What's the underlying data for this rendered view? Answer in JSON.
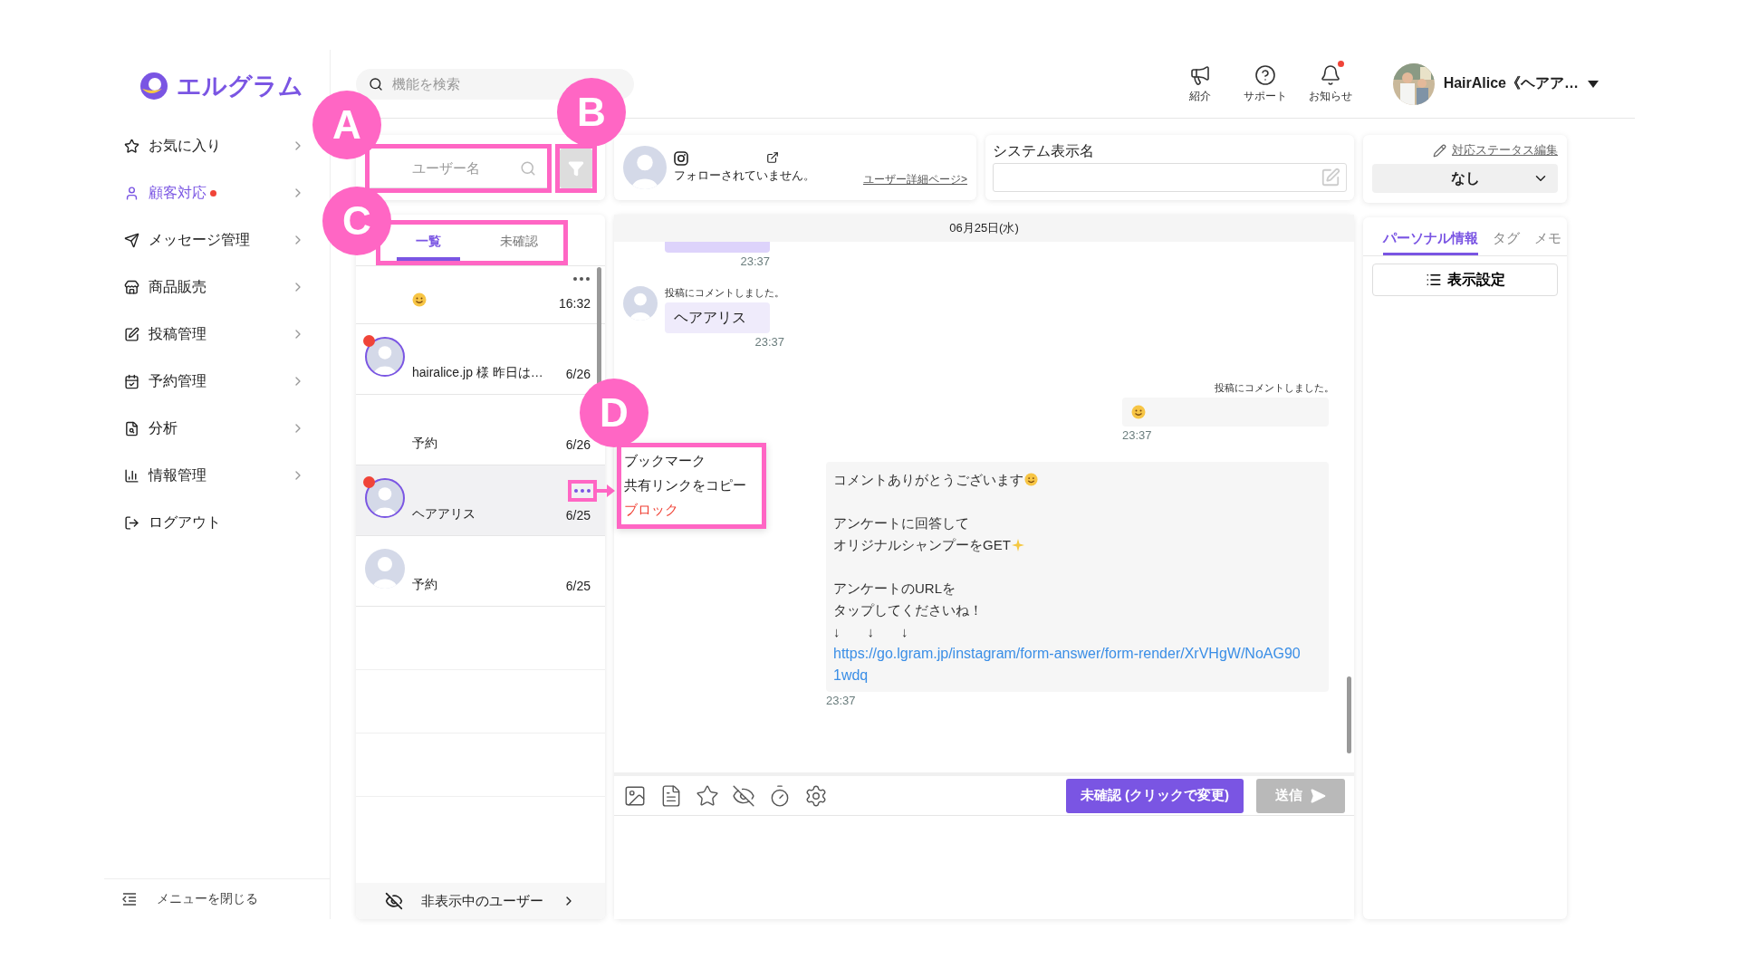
{
  "logo": {
    "text": "エルグラム"
  },
  "sidebar": {
    "items": [
      {
        "label": "お気に入り",
        "selected": false,
        "alert": false
      },
      {
        "label": "顧客対応",
        "selected": true,
        "alert": true
      },
      {
        "label": "メッセージ管理",
        "selected": false,
        "alert": false
      },
      {
        "label": "商品販売",
        "selected": false,
        "alert": false
      },
      {
        "label": "投稿管理",
        "selected": false,
        "alert": false
      },
      {
        "label": "予約管理",
        "selected": false,
        "alert": false
      },
      {
        "label": "分析",
        "selected": false,
        "alert": false
      },
      {
        "label": "情報管理",
        "selected": false,
        "alert": false
      },
      {
        "label": "ログアウト",
        "selected": false,
        "alert": false
      }
    ],
    "collapse": "メニューを閉じる"
  },
  "header": {
    "search_placeholder": "機能を検索",
    "actions": [
      {
        "label": "紹介",
        "alert": false
      },
      {
        "label": "サポート",
        "alert": false
      },
      {
        "label": "お知らせ",
        "alert": true
      }
    ],
    "user": {
      "name": "HairAlice《ヘアア…"
    }
  },
  "user_list": {
    "search": {
      "placeholder": "ユーザー名",
      "annotation": "A"
    },
    "filter": {
      "annotation": "B"
    },
    "tabs": {
      "annotation": "C",
      "items": [
        {
          "label": "一覧",
          "selected": true
        },
        {
          "label": "未確認",
          "selected": false
        }
      ]
    },
    "rows": [
      {
        "kind": "emoji",
        "avatar": false,
        "unread": false,
        "selected": false,
        "menu": true,
        "time": "16:32"
      },
      {
        "kind": "text",
        "avatar": true,
        "unread": true,
        "selected": false,
        "menu": false,
        "preview": "hairalice.jp 様 昨日は…",
        "time": "6/26"
      },
      {
        "kind": "text",
        "avatar": false,
        "unread": false,
        "selected": false,
        "menu": false,
        "preview": "予約",
        "time": "6/26"
      },
      {
        "kind": "text",
        "avatar": true,
        "unread": true,
        "selected": true,
        "menu": true,
        "preview": "ヘアアリス",
        "time": "6/25",
        "annotation": "D"
      },
      {
        "kind": "text",
        "avatar": true,
        "unread": false,
        "selected": false,
        "menu": false,
        "preview": "予約",
        "time": "6/25"
      }
    ],
    "hidden_users": "非表示中のユーザー"
  },
  "context_menu": {
    "items": [
      {
        "label": "ブックマーク",
        "kind": "normal"
      },
      {
        "label": "共有リンクをコピー",
        "kind": "normal"
      },
      {
        "label": "ブロック",
        "kind": "danger"
      }
    ]
  },
  "profile": {
    "status": "フォローされていません。",
    "link": "ユーザー詳細ページ>"
  },
  "system_name": {
    "label": "システム表示名"
  },
  "chat": {
    "date": "06月25日(水)",
    "messages": [
      {
        "kind": "clipped",
        "time": "23:37"
      },
      {
        "kind": "incoming",
        "note": "投稿にコメントしました。",
        "text": "ヘアアリス",
        "time": "23:37"
      },
      {
        "kind": "outgoing_emoji",
        "note": "投稿にコメントしました。",
        "time": "23:37"
      },
      {
        "kind": "outgoing",
        "paragraphs": [
          [
            {
              "kind": "smile",
              "text": "コメントありがとうございます"
            }
          ],
          [
            {
              "kind": "plain",
              "text": "アンケートに回答して"
            },
            {
              "kind": "sparkle",
              "text": "オリジナルシャンプーをGET"
            }
          ],
          [
            {
              "kind": "plain",
              "text": "アンケートのURLを"
            },
            {
              "kind": "plain",
              "text": "タップしてくださいね！"
            },
            {
              "kind": "plain",
              "text": "↓　　↓　　↓"
            }
          ]
        ],
        "link": "https://go.lgram.jp/instagram/form-answer/form-render/XrVHgW/NoAG901wdq",
        "time": "23:37"
      }
    ]
  },
  "composer": {
    "status_button": "未確認 (クリックで変更)",
    "send": "送信",
    "send_disabled": true
  },
  "status": {
    "edit_link": "対応ステータス編集",
    "value": "なし"
  },
  "info": {
    "tabs": [
      {
        "label": "パーソナル情報",
        "selected": true
      },
      {
        "label": "タグ",
        "selected": false
      },
      {
        "label": "メモ",
        "selected": false
      }
    ],
    "display_settings": "表示設定"
  }
}
